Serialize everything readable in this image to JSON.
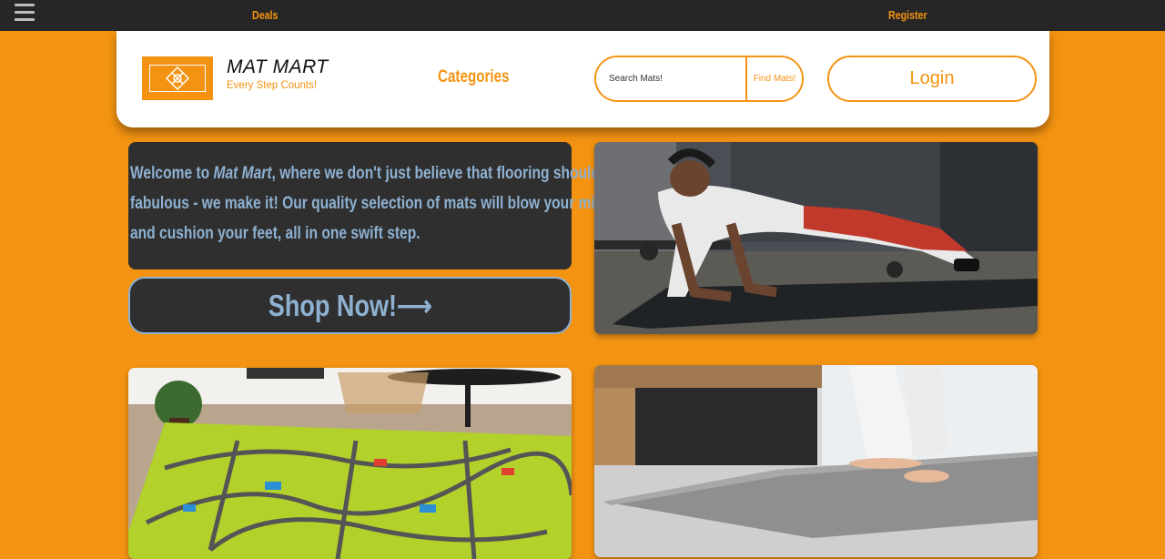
{
  "topbar": {
    "menu_icon": "hamburger-menu-icon",
    "deals": "Deals",
    "register": "Register"
  },
  "header": {
    "logo_icon": "diamond-knot-logo-icon",
    "brand_name": "MAT MART",
    "tagline": "Every Step Counts!",
    "categories": "Categories",
    "search_placeholder": "Search Mats!",
    "find_button": "Find Mats!",
    "login_button": "Login"
  },
  "hero": {
    "welcome_prefix": "Welcome to ",
    "welcome_brand": "Mat Mart",
    "welcome_suffix": ", where we don't just believe that flooring should be fabulous - we make it! Our quality selection of mats will blow your mind and cushion your feet, all in one swift step.",
    "shop_button": "Shop Now!⟶"
  },
  "colors": {
    "accent": "#f39311",
    "dark": "#2f2f2f",
    "topbar": "#262626",
    "hero_text": "#8eb1d1"
  }
}
